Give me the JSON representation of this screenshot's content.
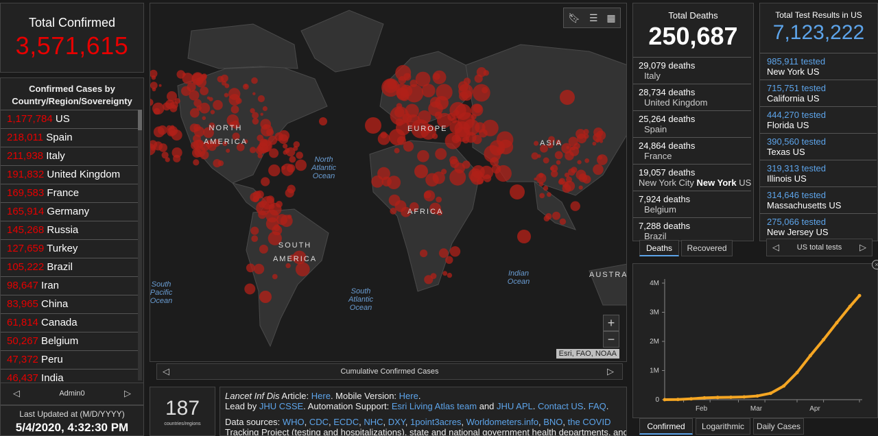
{
  "total_confirmed": {
    "label": "Total Confirmed",
    "value": "3,571,615"
  },
  "confirmed_list": {
    "header": "Confirmed Cases by Country/Region/Sovereignty",
    "rows": [
      {
        "count": "1,177,784",
        "name": "US"
      },
      {
        "count": "218,011",
        "name": "Spain"
      },
      {
        "count": "211,938",
        "name": "Italy"
      },
      {
        "count": "191,832",
        "name": "United Kingdom"
      },
      {
        "count": "169,583",
        "name": "France"
      },
      {
        "count": "165,914",
        "name": "Germany"
      },
      {
        "count": "145,268",
        "name": "Russia"
      },
      {
        "count": "127,659",
        "name": "Turkey"
      },
      {
        "count": "105,222",
        "name": "Brazil"
      },
      {
        "count": "98,647",
        "name": "Iran"
      },
      {
        "count": "83,965",
        "name": "China"
      },
      {
        "count": "61,814",
        "name": "Canada"
      },
      {
        "count": "50,267",
        "name": "Belgium"
      },
      {
        "count": "47,372",
        "name": "Peru"
      },
      {
        "count": "46,437",
        "name": "India"
      }
    ],
    "footer": "Admin0"
  },
  "last_updated": {
    "label": "Last Updated at (M/D/YYYY)",
    "value": "5/4/2020, 4:32:30 PM"
  },
  "map": {
    "footer": "Cumulative Confirmed Cases",
    "attribution": "Esri, FAO, NOAA",
    "zoom_in": "+",
    "zoom_out": "−",
    "labels": {
      "north_america": "NORTH AMERICA",
      "south_america": "SOUTH AMERICA",
      "europe": "EUROPE",
      "asia": "ASIA",
      "africa": "AFRICA",
      "australia": "AUSTRA",
      "north_atlantic": "North Atlantic Ocean",
      "south_atlantic": "South Atlantic Ocean",
      "south_pacific": "South Pacific Ocean",
      "indian": "Indian Ocean"
    },
    "icons": [
      "bookmark-icon",
      "list-icon",
      "qr-code-icon"
    ]
  },
  "countries_count": {
    "value": "187",
    "label": "countries/regions"
  },
  "info": {
    "line1_prefix": "Lancet Inf Dis",
    "line1_text": " Article: ",
    "line1_link1": "Here",
    "line1_mid": ". Mobile Version: ",
    "line1_link2": "Here",
    "line1_end": ".",
    "line2_prefix": "Lead by ",
    "line2_link1": "JHU CSSE",
    "line2_mid": ". Automation Support: ",
    "line2_link2": "Esri Living Atlas team",
    "line2_and": " and ",
    "line2_link3": "JHU APL",
    "line2_dot": ". ",
    "line2_link4": "Contact US",
    "line2_dot2": ". ",
    "line2_link5": "FAQ",
    "line2_end": ".",
    "line3_prefix": "Data sources: ",
    "line3_sources": [
      "WHO",
      "CDC",
      "ECDC",
      "NHC",
      "DXY",
      "1point3acres",
      "Worldometers.info",
      "BNO",
      "the COVID"
    ],
    "line4_partial": "Tracking Project (testing and hospitalizations), state and national government health departments, and"
  },
  "total_deaths": {
    "label": "Total Deaths",
    "value": "250,687",
    "rows": [
      {
        "count": "29,079",
        "unit": "deaths",
        "loc": "Italy",
        "sub": ""
      },
      {
        "count": "28,734",
        "unit": "deaths",
        "loc": "United Kingdom",
        "sub": ""
      },
      {
        "count": "25,264",
        "unit": "deaths",
        "loc": "Spain",
        "sub": ""
      },
      {
        "count": "24,864",
        "unit": "deaths",
        "loc": "France",
        "sub": ""
      },
      {
        "count": "19,057",
        "unit": "deaths",
        "loc": "New York City",
        "bold": "New York",
        "sub": "US"
      },
      {
        "count": "7,924",
        "unit": "deaths",
        "loc": "Belgium",
        "sub": ""
      },
      {
        "count": "7,288",
        "unit": "deaths",
        "loc": "Brazil",
        "sub": ""
      }
    ],
    "tabs": [
      "Deaths",
      "Recovered"
    ]
  },
  "total_tests": {
    "label": "Total Test Results in US",
    "value": "7,123,222",
    "rows": [
      {
        "count": "985,911",
        "unit": "tested",
        "loc": "New York",
        "sub": "US"
      },
      {
        "count": "715,751",
        "unit": "tested",
        "loc": "California",
        "sub": "US"
      },
      {
        "count": "444,270",
        "unit": "tested",
        "loc": "Florida",
        "sub": "US"
      },
      {
        "count": "390,560",
        "unit": "tested",
        "loc": "Texas",
        "sub": "US"
      },
      {
        "count": "319,313",
        "unit": "tested",
        "loc": "Illinois",
        "sub": "US"
      },
      {
        "count": "314,646",
        "unit": "tested",
        "loc": "Massachusetts",
        "sub": "US"
      },
      {
        "count": "275,066",
        "unit": "tested",
        "loc": "New Jersey",
        "sub": "US"
      }
    ],
    "footer": "US total tests"
  },
  "chart_tabs": [
    "Confirmed",
    "Logarithmic",
    "Daily Cases"
  ],
  "colors": {
    "confirmed": "#e60000",
    "tests": "#5da4ea",
    "curve": "#f5a623",
    "bubble": "#b02018"
  },
  "chart_data": {
    "type": "line",
    "title": "",
    "xlabel": "",
    "ylabel": "",
    "x_ticks": [
      "Feb",
      "Mar",
      "Apr"
    ],
    "y_ticks": [
      "0",
      "1M",
      "2M",
      "3M",
      "4M"
    ],
    "ylim": [
      0,
      4000000
    ],
    "series": [
      {
        "x": [
          "2020-01-22",
          "2020-01-29",
          "2020-02-05",
          "2020-02-12",
          "2020-02-19",
          "2020-02-26",
          "2020-03-04",
          "2020-03-11",
          "2020-03-18",
          "2020-03-25",
          "2020-04-01",
          "2020-04-08",
          "2020-04-15",
          "2020-04-22",
          "2020-04-29",
          "2020-05-04"
        ],
        "values": [
          600,
          7000,
          28000,
          60000,
          76000,
          82000,
          95000,
          126000,
          220000,
          470000,
          930000,
          1510000,
          2060000,
          2640000,
          3200000,
          3571615
        ]
      }
    ],
    "grid": false
  }
}
